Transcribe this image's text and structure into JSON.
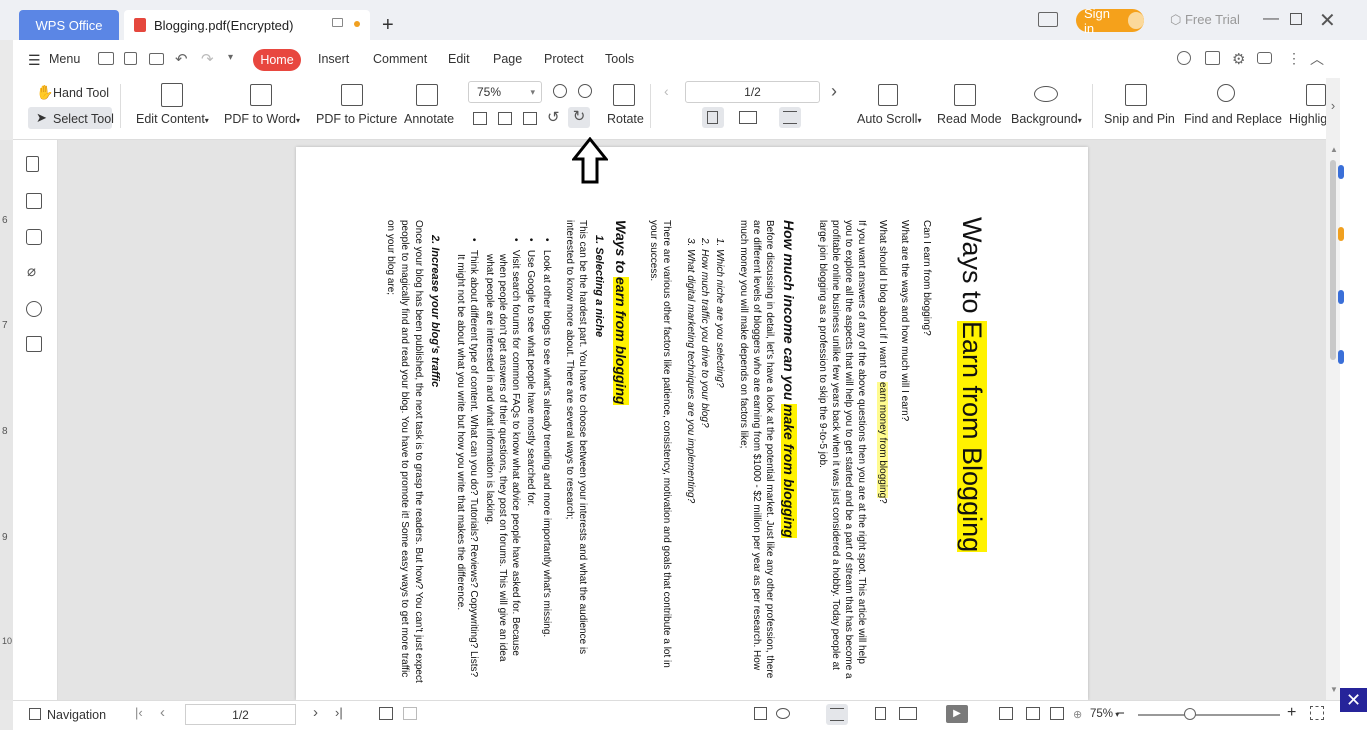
{
  "titlebar": {
    "app_tab": "WPS Office",
    "doc_tab": "Blogging.pdf(Encrypted)",
    "new_tab_icon": "plus-icon",
    "sign_in": "Sign in",
    "free_trial": "Free Trial"
  },
  "menubar": {
    "menu": "Menu",
    "tabs": [
      "Home",
      "Insert",
      "Comment",
      "Edit",
      "Page",
      "Protect",
      "Tools"
    ]
  },
  "ribbon": {
    "hand_tool": "Hand Tool",
    "select_tool": "Select Tool",
    "edit_content": "Edit Content",
    "pdf_to_word": "PDF to Word",
    "pdf_to_picture": "PDF to Picture",
    "annotate": "Annotate",
    "zoom": "75%",
    "rotate": "Rotate",
    "page": "1/2",
    "auto_scroll": "Auto Scroll",
    "read_mode": "Read Mode",
    "background": "Background",
    "snip_and_pin": "Snip and Pin",
    "find_and_replace": "Find and Replace",
    "highlight": "Highlig"
  },
  "ruler": [
    "6",
    "7",
    "8",
    "9",
    "10"
  ],
  "document": {
    "title_prefix": "Ways to ",
    "title_highlight": "Earn from Blogging",
    "q1": "Can I earn from blogging?",
    "q2": "What are the ways and how much will I earn?",
    "q3_prefix": "What should I blog about if I want to ",
    "q3_highlight": "earn money from blogging",
    "q3_suffix": "?",
    "p1_l1": "If you want answers of any of the above questions then you are at the right spot. This article will help",
    "p1_l2": "you to explore all the aspects that will help you to get started and be a part of stream that has become a",
    "p1_l3": "profitable online business unlike few years back when it was just considered a hobby. Today people at",
    "p1_l4": "large join blogging as a profession to skip the 9-to-5 job.",
    "h2_prefix": "How much income can you ",
    "h2_highlight": "make from blogging",
    "p2_l1": "Before discussing in detail, let's have a look at the potential market. Just like any other profession, there",
    "p2_l2": "are different levels of bloggers who are earning from $1000 - $2 million per year as per research. How",
    "p2_l3": "much money you will make depends on factors like;",
    "list1": [
      "1.   Which niche are you selecting?",
      "2.   How much traffic you drive to your blog?",
      "3.   What digital marketing techniques are you implementing?"
    ],
    "p3_l1": "There are various other factors like patience, consistency, motivation and goals that contribute a lot in",
    "p3_l2": "your success.",
    "h3_prefix": "Ways to ",
    "h3_highlight": "earn from blogging",
    "sub1": "1.   Selecting a niche",
    "p4_l1": "This can be the hardest part. You have to choose between your interests and what the audience is",
    "p4_l2": "interested to know more about. There are several ways to research;",
    "bullets": [
      "Look at other blogs to see what's already trending and more importantly what's missing.",
      "Use Google to see what people have mostly searched for.",
      "Visit search forums for common FAQs to know what advice people have asked for. Because",
      "when people don't get answers of their questions, they post on forums. This will give an idea",
      "what people are interested in and what information is lacking.",
      "Think about different type of content. What can you do? Tutorials? Reviews? Copywriting? Lists?",
      "It might not be about what you write but how you write that makes the difference."
    ],
    "sub2": "2.   Increase your blog's traffic",
    "p5_l1": "Once your blog has been published, the next task is to grasp the readers. But how? You can't just expect",
    "p5_l2": "people to magically find and read your blog. You have to promote it! Some easy ways to get more traffic",
    "p5_l3": "on your blog are;"
  },
  "statusbar": {
    "navigation": "Navigation",
    "page": "1/2",
    "zoom": "75%"
  }
}
